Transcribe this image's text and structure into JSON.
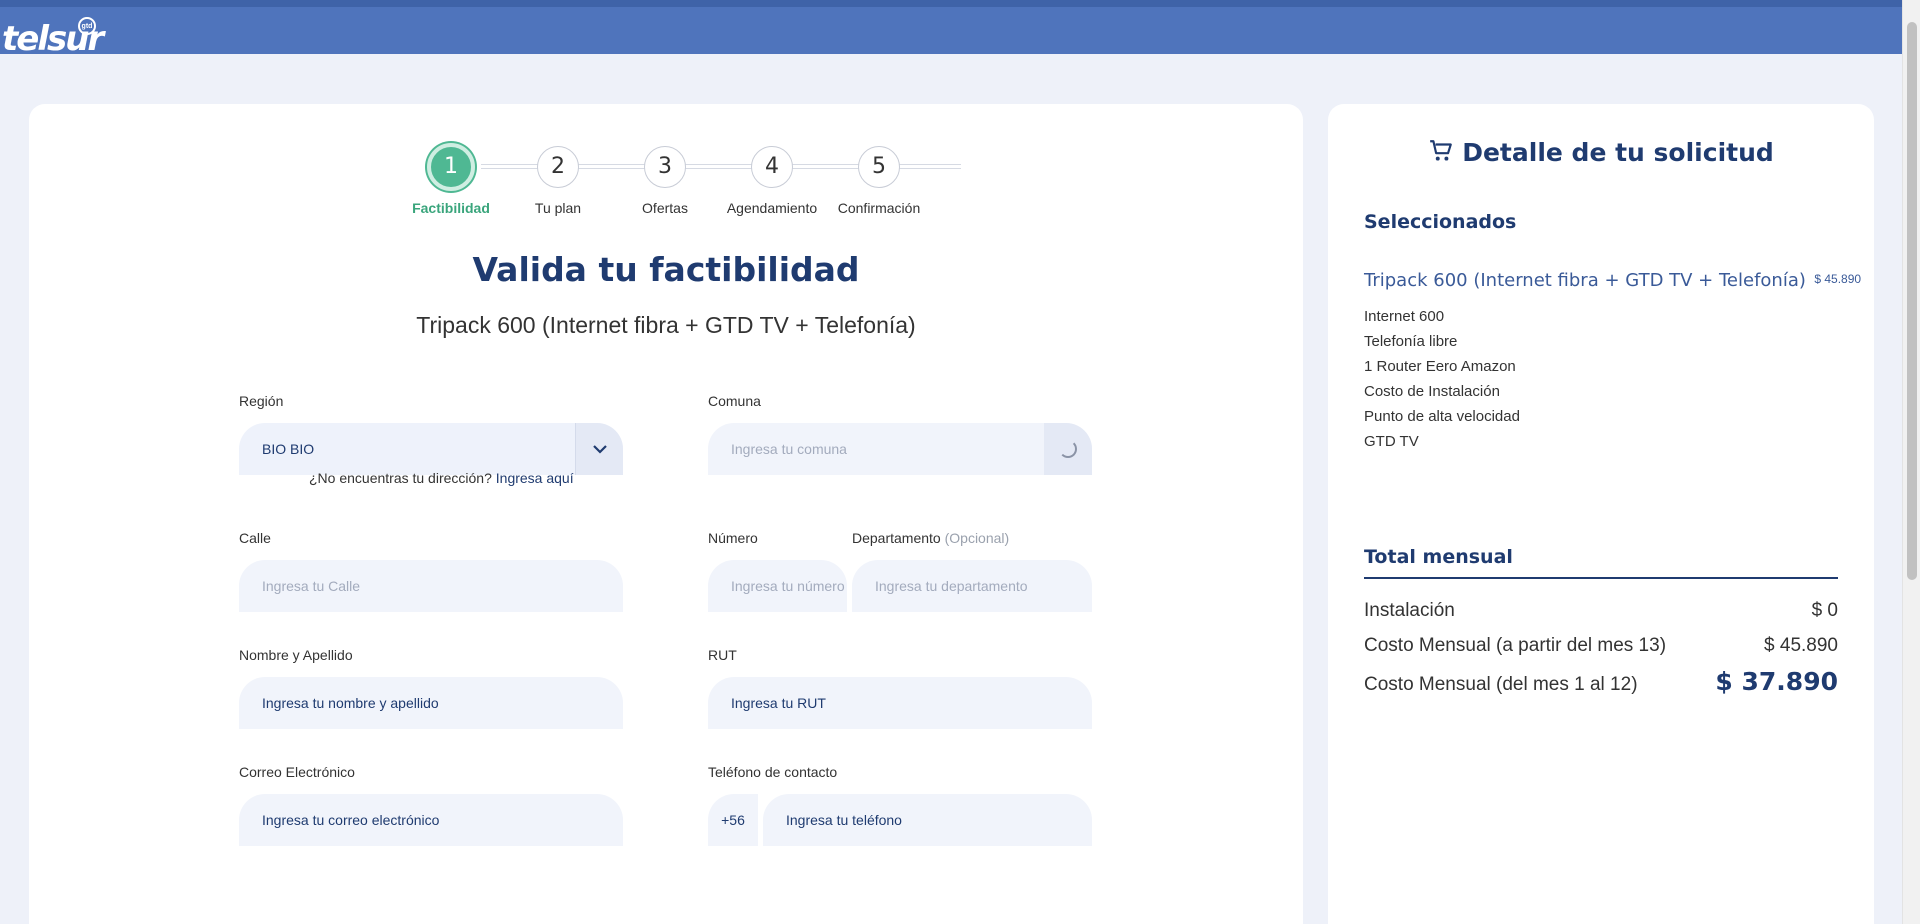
{
  "brand": {
    "logo": "telsur",
    "badge": "gtd",
    "colors": {
      "header": "#4f74bc",
      "primary": "#1f3b70",
      "success": "#4fb893"
    }
  },
  "stepper": [
    {
      "num": "1",
      "label": "Factibilidad",
      "active": true
    },
    {
      "num": "2",
      "label": "Tu plan"
    },
    {
      "num": "3",
      "label": "Ofertas"
    },
    {
      "num": "4",
      "label": "Agendamiento"
    },
    {
      "num": "5",
      "label": "Confirmación"
    }
  ],
  "form": {
    "title": "Valida tu factibilidad",
    "plan": "Tripack 600 (Internet fibra + GTD TV + Telefonía)",
    "region": {
      "label": "Región",
      "value": "BIO BIO",
      "icon": "chevron-down-icon"
    },
    "missing_address": {
      "text": "¿No encuentras tu dirección?",
      "link": "Ingresa aquí"
    },
    "comuna": {
      "label": "Comuna",
      "placeholder": "Ingresa tu comuna",
      "icon": "spinner-icon"
    },
    "calle": {
      "label": "Calle",
      "placeholder": "Ingresa tu Calle"
    },
    "numero": {
      "label": "Número",
      "placeholder": "Ingresa tu número"
    },
    "departamento": {
      "label": "Departamento",
      "optional": "(Opcional)",
      "placeholder": "Ingresa tu departamento"
    },
    "nombre": {
      "label": "Nombre y Apellido",
      "placeholder": "Ingresa tu nombre y apellido"
    },
    "rut": {
      "label": "RUT",
      "placeholder": "Ingresa tu RUT"
    },
    "correo": {
      "label": "Correo Electrónico",
      "placeholder": "Ingresa tu correo electrónico"
    },
    "telefono": {
      "label": "Teléfono de contacto",
      "prefix": "+56",
      "placeholder": "Ingresa tu teléfono"
    }
  },
  "summary": {
    "title": "Detalle de tu solicitud",
    "icon": "cart-icon",
    "selected_heading": "Seleccionados",
    "plan_name": "Tripack 600 (Internet fibra + GTD TV + Telefonía)",
    "plan_price": "$ 45.890",
    "items": [
      "Internet 600",
      "Telefonía libre",
      "1 Router Eero Amazon",
      "Costo de Instalación",
      "Punto de alta velocidad",
      "GTD TV"
    ],
    "total_heading": "Total mensual",
    "rows": [
      {
        "label": "Instalación",
        "value": "$ 0"
      },
      {
        "label": "Costo Mensual (a partir del mes 13)",
        "value": "$ 45.890"
      },
      {
        "label": "Costo Mensual (del mes 1 al 12)",
        "value": "$ 37.890"
      }
    ]
  }
}
